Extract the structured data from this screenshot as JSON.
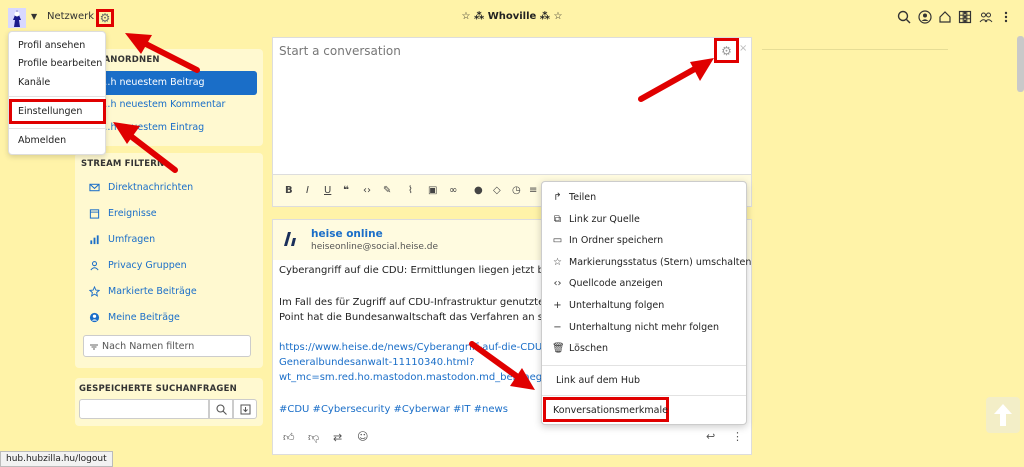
{
  "topbar": {
    "network_label": "Netzwerk",
    "site_title": "☆ ⁂ Whoville ⁂ ☆",
    "icons": [
      "search-icon",
      "user-icon",
      "home-icon",
      "more-vertical-icon",
      "grid-icon",
      "people-icon",
      "dots-vertical-icon"
    ]
  },
  "dropdown": {
    "items": [
      "Profil ansehen",
      "Profile bearbeiten",
      "Kanäle",
      "Einstellungen",
      "Abmelden"
    ]
  },
  "sidebar": {
    "sort": {
      "title": "…M ANORDNEN",
      "items": [
        "…h neuestem Beitrag",
        "…h neuestem Kommentar",
        "…h neuestem Eintrag"
      ]
    },
    "filter": {
      "title": "STREAM FILTERN",
      "items": [
        "Direktnachrichten",
        "Ereignisse",
        "Umfragen",
        "Privacy Gruppen",
        "Markierte Beiträge",
        "Meine Beiträge"
      ],
      "name_filter_placeholder": "Nach Namen filtern"
    },
    "saved_searches": {
      "title": "GESPEICHERTE SUCHANFRAGEN"
    }
  },
  "composer": {
    "placeholder": "Start a conversation"
  },
  "post": {
    "author": "heise online",
    "handle": "heiseonline@social.heise.de",
    "line1": "Cyberangriff auf die CDU: Ermittlungen liegen jetzt bei",
    "line2": "Im Fall des für Zugriff auf CDU-Infrastruktur genutzten",
    "line3": "Point hat die Bundesanwaltschaft das Verfahren an sic",
    "link1": "https://www.heise.de/news/Cyberangriff-auf-die-CDU-E",
    "link2": "Generalbundesanwalt-11110340.html?",
    "link3": "wt_mc=sm.red.ho.mastodon.mastodon.md_beitraege.",
    "tags": "#CDU #Cybersecurity #Cyberwar #IT #news"
  },
  "context_menu": {
    "items": [
      "Teilen",
      "Link zur Quelle",
      "In Ordner speichern",
      "Markierungsstatus (Stern) umschalten",
      "Quellcode anzeigen",
      "Unterhaltung folgen",
      "Unterhaltung nicht mehr folgen",
      "Löschen"
    ],
    "hub_link": "Link auf dem Hub",
    "conversation_features": "Konversationsmerkmale"
  },
  "status_bar": {
    "url": "hub.hubzilla.hu/logout"
  },
  "colors": {
    "background": "#fff3a8",
    "accent": "#1a6ec8",
    "highlight": "#e00000"
  }
}
